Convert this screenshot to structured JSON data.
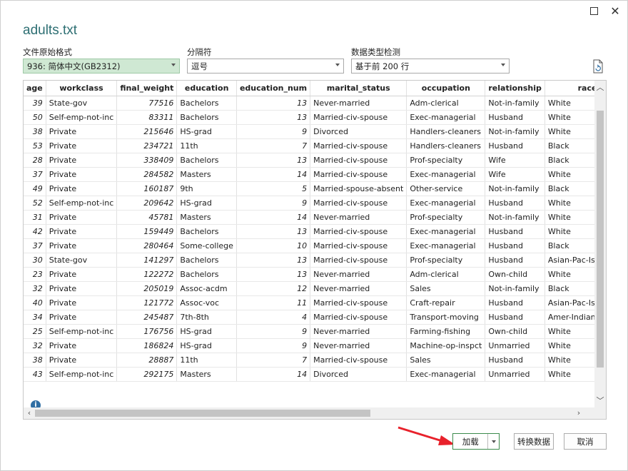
{
  "window": {
    "title": "adults.txt"
  },
  "origin": {
    "label": "文件原始格式",
    "value": "936: 简体中文(GB2312)"
  },
  "delimiter": {
    "label": "分隔符",
    "value": "逗号"
  },
  "detect": {
    "label": "数据类型检测",
    "value": "基于前 200 行"
  },
  "grid": {
    "columns": [
      "age",
      "workclass",
      "final_weight",
      "education",
      "education_num",
      "marital_status",
      "occupation",
      "relationship",
      "race"
    ],
    "rows": [
      [
        "39",
        "State-gov",
        "77516",
        "Bachelors",
        "13",
        "Never-married",
        "Adm-clerical",
        "Not-in-family",
        "White"
      ],
      [
        "50",
        "Self-emp-not-inc",
        "83311",
        "Bachelors",
        "13",
        "Married-civ-spouse",
        "Exec-managerial",
        "Husband",
        "White"
      ],
      [
        "38",
        "Private",
        "215646",
        "HS-grad",
        "9",
        "Divorced",
        "Handlers-cleaners",
        "Not-in-family",
        "White"
      ],
      [
        "53",
        "Private",
        "234721",
        "11th",
        "7",
        "Married-civ-spouse",
        "Handlers-cleaners",
        "Husband",
        "Black"
      ],
      [
        "28",
        "Private",
        "338409",
        "Bachelors",
        "13",
        "Married-civ-spouse",
        "Prof-specialty",
        "Wife",
        "Black"
      ],
      [
        "37",
        "Private",
        "284582",
        "Masters",
        "14",
        "Married-civ-spouse",
        "Exec-managerial",
        "Wife",
        "White"
      ],
      [
        "49",
        "Private",
        "160187",
        "9th",
        "5",
        "Married-spouse-absent",
        "Other-service",
        "Not-in-family",
        "Black"
      ],
      [
        "52",
        "Self-emp-not-inc",
        "209642",
        "HS-grad",
        "9",
        "Married-civ-spouse",
        "Exec-managerial",
        "Husband",
        "White"
      ],
      [
        "31",
        "Private",
        "45781",
        "Masters",
        "14",
        "Never-married",
        "Prof-specialty",
        "Not-in-family",
        "White"
      ],
      [
        "42",
        "Private",
        "159449",
        "Bachelors",
        "13",
        "Married-civ-spouse",
        "Exec-managerial",
        "Husband",
        "White"
      ],
      [
        "37",
        "Private",
        "280464",
        "Some-college",
        "10",
        "Married-civ-spouse",
        "Exec-managerial",
        "Husband",
        "Black"
      ],
      [
        "30",
        "State-gov",
        "141297",
        "Bachelors",
        "13",
        "Married-civ-spouse",
        "Prof-specialty",
        "Husband",
        "Asian-Pac-Islander"
      ],
      [
        "23",
        "Private",
        "122272",
        "Bachelors",
        "13",
        "Never-married",
        "Adm-clerical",
        "Own-child",
        "White"
      ],
      [
        "32",
        "Private",
        "205019",
        "Assoc-acdm",
        "12",
        "Never-married",
        "Sales",
        "Not-in-family",
        "Black"
      ],
      [
        "40",
        "Private",
        "121772",
        "Assoc-voc",
        "11",
        "Married-civ-spouse",
        "Craft-repair",
        "Husband",
        "Asian-Pac-Islander"
      ],
      [
        "34",
        "Private",
        "245487",
        "7th-8th",
        "4",
        "Married-civ-spouse",
        "Transport-moving",
        "Husband",
        "Amer-Indian-Eskimo"
      ],
      [
        "25",
        "Self-emp-not-inc",
        "176756",
        "HS-grad",
        "9",
        "Never-married",
        "Farming-fishing",
        "Own-child",
        "White"
      ],
      [
        "32",
        "Private",
        "186824",
        "HS-grad",
        "9",
        "Never-married",
        "Machine-op-inspct",
        "Unmarried",
        "White"
      ],
      [
        "38",
        "Private",
        "28887",
        "11th",
        "7",
        "Married-civ-spouse",
        "Sales",
        "Husband",
        "White"
      ],
      [
        "43",
        "Self-emp-not-inc",
        "292175",
        "Masters",
        "14",
        "Divorced",
        "Exec-managerial",
        "Unmarried",
        "White"
      ]
    ]
  },
  "buttons": {
    "load": "加载",
    "transform": "转换数据",
    "cancel": "取消"
  },
  "colors": {
    "title": "#2e6f73",
    "active_select": "#cfe8d3",
    "load_border": "#3c8c4c",
    "annotation_arrow": "#e8212b"
  },
  "icons": [
    "maximize-icon",
    "close-icon",
    "refresh-icon",
    "chevron-down-icon",
    "info-icon"
  ]
}
